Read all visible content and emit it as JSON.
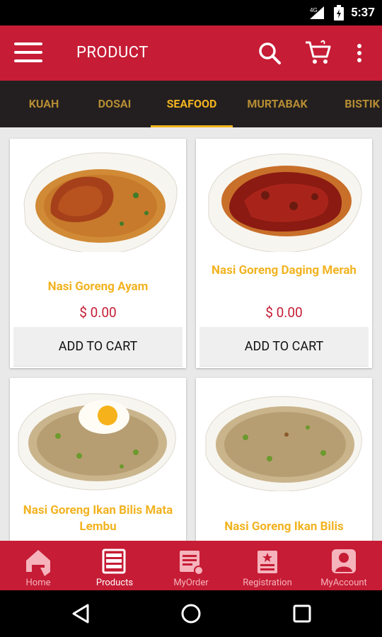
{
  "status_bar": {
    "time": "5:37",
    "network": "4G"
  },
  "app_bar": {
    "title": "PRODUCT"
  },
  "colors": {
    "primary": "#c61c35",
    "accent": "#f2b321",
    "tab_bg": "#231f20"
  },
  "tabs": [
    {
      "label": "KUAH",
      "active": false
    },
    {
      "label": "DOSAI",
      "active": false
    },
    {
      "label": "SEAFOOD",
      "active": true
    },
    {
      "label": "MURTABAK",
      "active": false
    },
    {
      "label": "BISTIK",
      "active": false
    }
  ],
  "products": [
    {
      "name": "Nasi Goreng Ayam",
      "price": "$ 0.00",
      "button": "ADD TO CART"
    },
    {
      "name": "Nasi Goreng Daging Merah",
      "price": "$ 0.00",
      "button": "ADD TO CART"
    },
    {
      "name": "Nasi Goreng Ikan Bilis Mata Lembu",
      "price": "",
      "button": ""
    },
    {
      "name": "Nasi Goreng Ikan Bilis",
      "price": "",
      "button": ""
    }
  ],
  "bottom_nav": [
    {
      "label": "Home",
      "icon": "home-icon",
      "active": false
    },
    {
      "label": "Products",
      "icon": "products-icon",
      "active": true
    },
    {
      "label": "MyOrder",
      "icon": "myorder-icon",
      "active": false
    },
    {
      "label": "Registration",
      "icon": "registration-icon",
      "active": false
    },
    {
      "label": "MyAccount",
      "icon": "myaccount-icon",
      "active": false
    }
  ]
}
